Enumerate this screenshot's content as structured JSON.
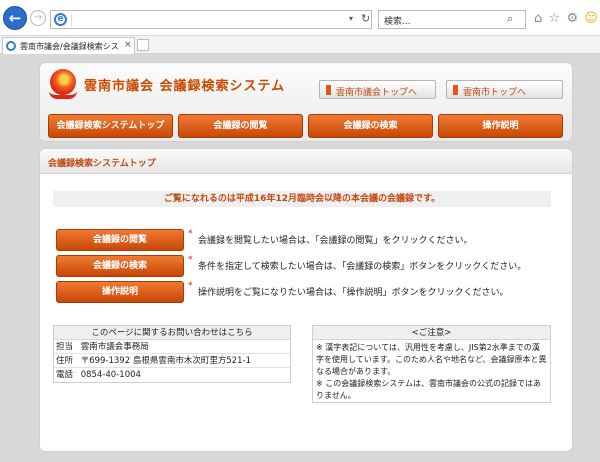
{
  "browser": {
    "address_value": "",
    "search_placeholder": "検索...",
    "tab_title": "雲南市議会/会議録検索シス…",
    "tab_close": "×",
    "back_glyph": "←",
    "forward_glyph": "→",
    "icons": [
      "home-icon",
      "star-icon",
      "gear-icon",
      "smiley-icon"
    ]
  },
  "header": {
    "site_title": "雲南市議会 会議録検索システム",
    "top_links": [
      "雲南市議会トップへ",
      "雲南市トップへ"
    ],
    "nav": [
      "会議録検索システムトップ",
      "会議録の閲覧",
      "会議録の検索",
      "操作説明"
    ]
  },
  "main": {
    "section_title": "会議録検索システムトップ",
    "notice": "ご覧になれるのは平成16年12月臨時会以降の本会議の会議録です。",
    "actions": [
      {
        "label": "会議録の閲覧",
        "desc": "会議録を閲覧したい場合は、「会議録の閲覧」をクリックください。"
      },
      {
        "label": "会議録の検索",
        "desc": "条件を指定して検索したい場合は、「会議録の検索」ボタンをクリックください。"
      },
      {
        "label": "操作説明",
        "desc": "操作説明をご覧になりたい場合は、「操作説明」ボタンをクリックください。"
      }
    ],
    "contact": {
      "title": "このページに関するお問い合わせはこちら",
      "rows": [
        {
          "k": "担当",
          "v": "雲南市議会事務局"
        },
        {
          "k": "住所",
          "v": "〒699-1392 島根県雲南市木次町里方521-1"
        },
        {
          "k": "電話",
          "v": "0854-40-1004"
        }
      ]
    },
    "caution": {
      "title": "<ご注意>",
      "lines": [
        "※ 漢字表記については、汎用性を考慮し、JIS第2水準までの漢字を使用しています。このため人名や地名など、会議録原本と異なる場合があります。",
        "※ この会議録検索システムは、雲南市議会の公式の記録ではありません。"
      ]
    }
  },
  "colors": {
    "accent": "#c94706",
    "title": "#c94a00",
    "link": "#2a6fcc"
  }
}
